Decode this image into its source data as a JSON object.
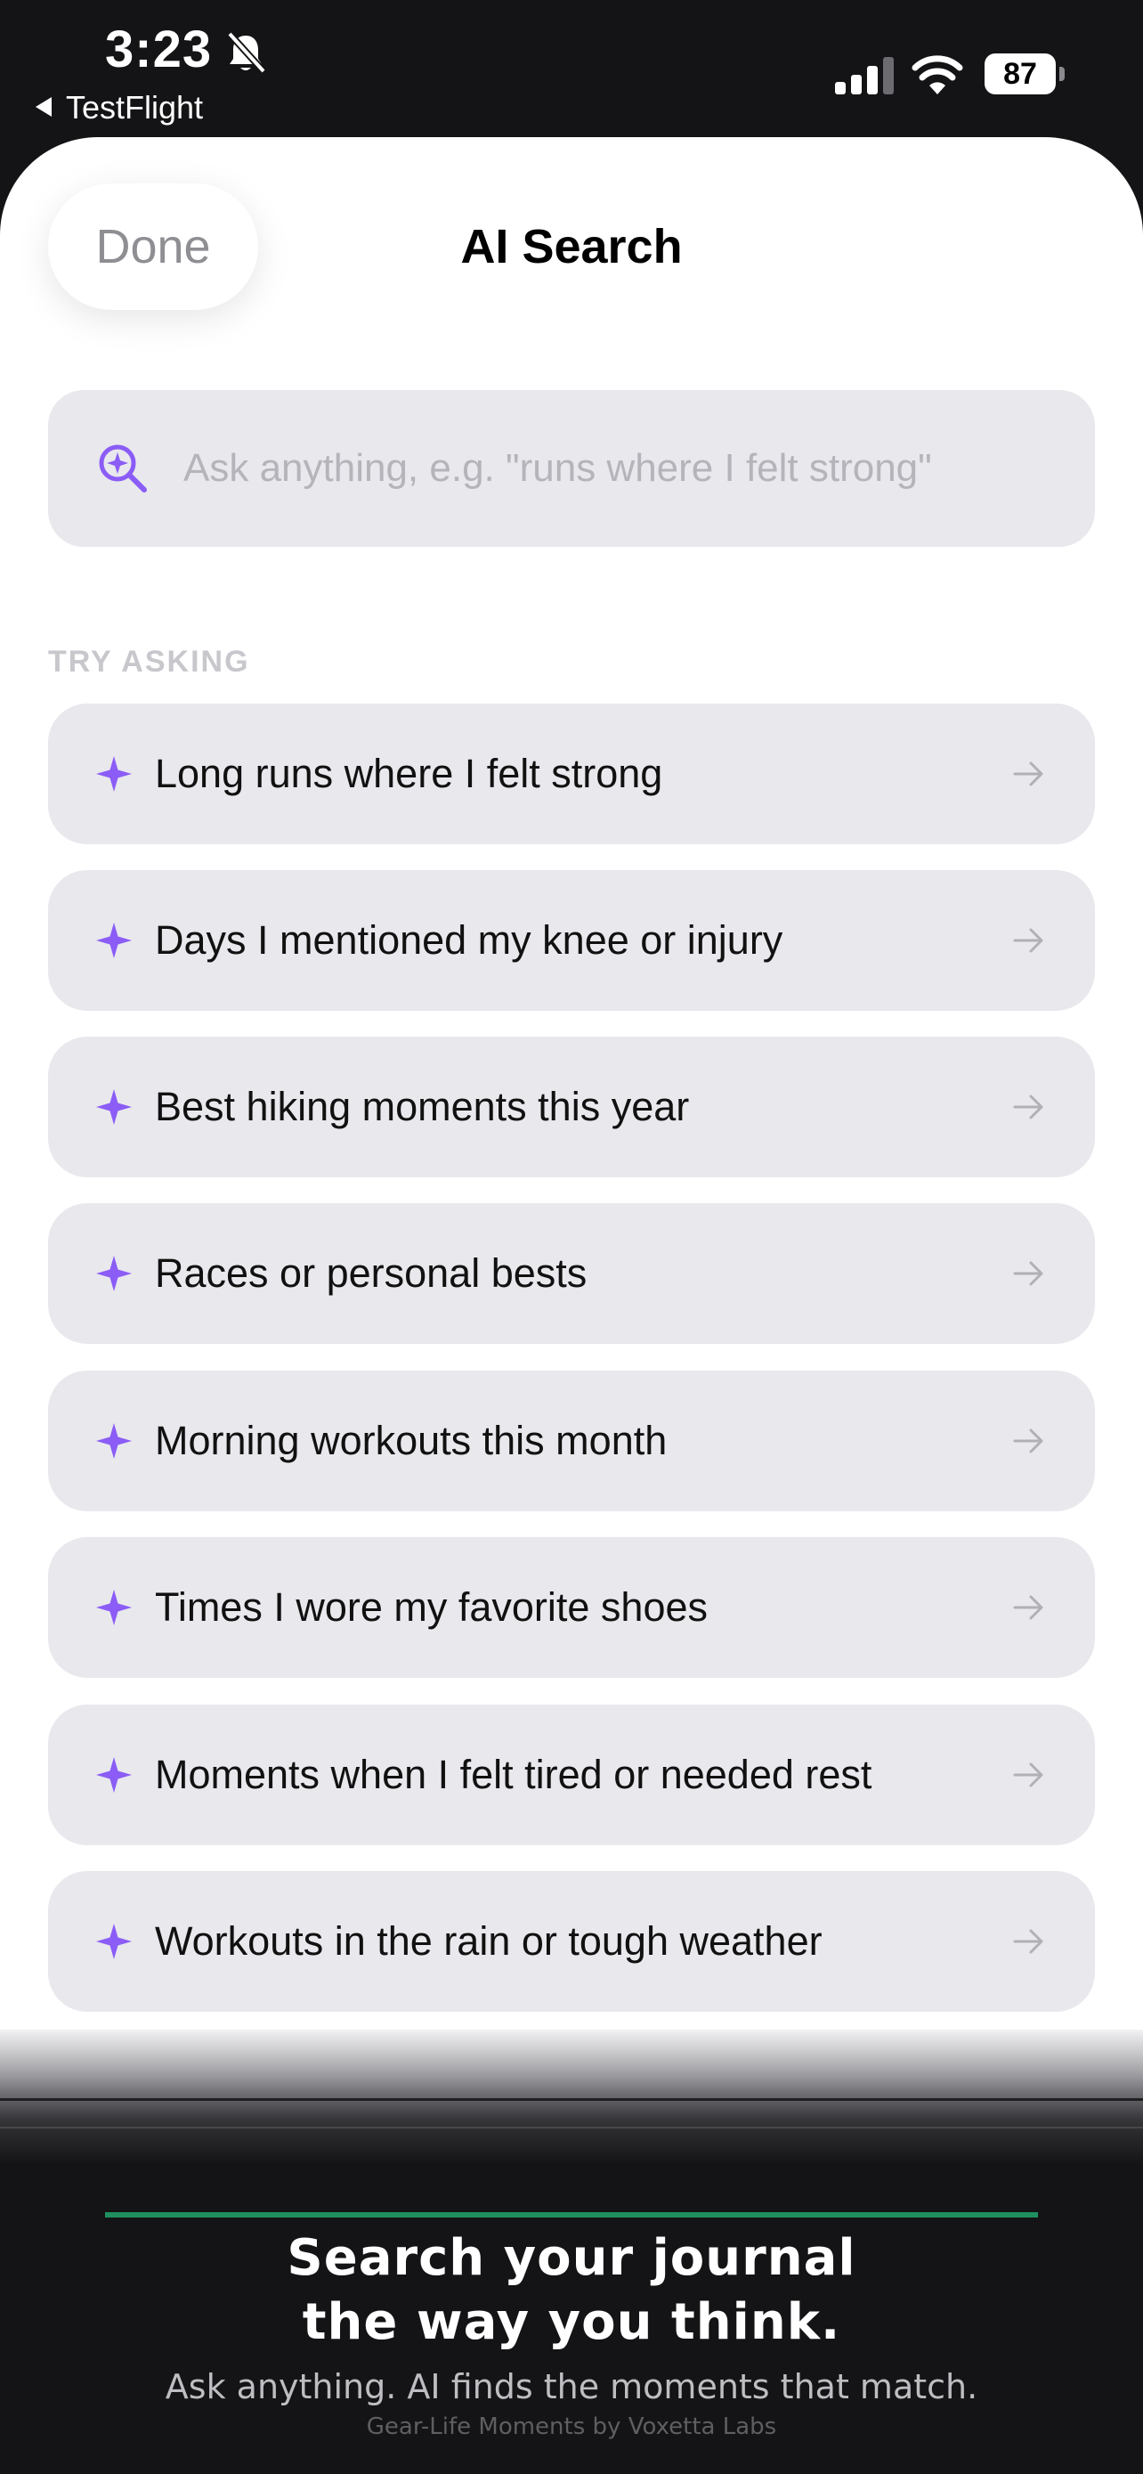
{
  "status_bar": {
    "time": "3:23",
    "back_label": "TestFlight",
    "battery": "87",
    "icons": [
      "bell-slash-icon",
      "signal-icon",
      "wifi-icon",
      "battery-icon"
    ]
  },
  "header": {
    "done_label": "Done",
    "title": "AI Search"
  },
  "search": {
    "placeholder": "Ask anything, e.g. \"runs where I felt strong\"",
    "value": "",
    "icon": "sparkle-magnifier-icon"
  },
  "suggestions": {
    "header": "TRY ASKING",
    "items": [
      {
        "label": "Long runs where I felt strong"
      },
      {
        "label": "Days I mentioned my knee or injury"
      },
      {
        "label": "Best hiking moments this year"
      },
      {
        "label": "Races or personal bests"
      },
      {
        "label": "Morning workouts this month"
      },
      {
        "label": "Times I wore my favorite shoes"
      },
      {
        "label": "Moments when I felt tired or needed rest"
      },
      {
        "label": "Workouts in the rain or tough weather"
      }
    ]
  },
  "promo": {
    "headline_line1": "Search your journal",
    "headline_line2": "the way you think.",
    "subtitle": "Ask anything. AI finds the moments that match.",
    "credit": "Gear-Life Moments by Voxetta Labs"
  },
  "colors": {
    "accent": "#8b5cf6",
    "card_background": "#e8e8ed",
    "promo_accent": "#1f8f5f"
  }
}
